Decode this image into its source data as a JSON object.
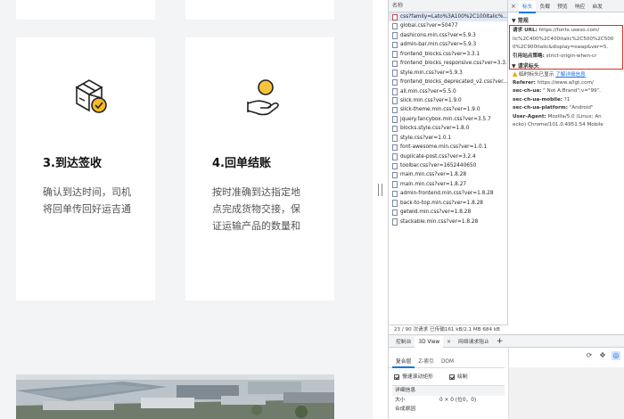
{
  "page": {
    "cards": [
      {
        "title": "3.到达签收",
        "desc_lines": [
          "确认到达时间，司机",
          "将回单传回好运吉通"
        ],
        "icon": "delivery-box-icon"
      },
      {
        "title": "4.回单结账",
        "desc_lines": [
          "按时准确到达指定地",
          "点完成货物交接，保",
          "证运输产品的数量和"
        ],
        "icon": "hand-coin-icon"
      }
    ],
    "photo_icon": "factory-aerial-photo"
  },
  "devtools": {
    "list_header": "名称",
    "requests": [
      "css?family=Lato%3A100%2C100italic%...",
      "global.css?ver=50477",
      "dashicons.min.css?ver=5.9.3",
      "admin-bar.min.css?ver=5.9.3",
      "frontend_blocks.css?ver=3.3.1",
      "frontend_blocks_responsive.css?ver=3.3.1",
      "style.min.css?ver=5.9.3",
      "frontend_blocks_deprecated_v2.css?ver...",
      "all.min.css?ver=5.5.0",
      "slick.min.css?ver=1.9.0",
      "slick-theme.min.css?ver=1.9.0",
      "jquery.fancybox.min.css?ver=3.5.7",
      "blocks.style.css?ver=1.8.0",
      "style.css?ver=1.0.1",
      "font-awesome.min.css?ver=1.0.1",
      "duplicate-post.css?ver=3.2.4",
      "toolbar.css?ver=1652440650",
      "main.min.css?ver=1.8.28",
      "main.min.css?ver=1.8.27",
      "admin-frontend.min.css?ver=1.8.28",
      "back-to-top.min.css?ver=1.8.28",
      "getwid.min.css?ver=1.8.28",
      "stackable.min.css?ver=1.8.28"
    ],
    "status_bar": "23 / 90 次请求  已传输161 kB/2.1 MB  684 kB",
    "detail_tabs": [
      "×",
      "标头",
      "负载",
      "预览",
      "响应",
      "启发"
    ],
    "general_label": "▼ 常规",
    "request_url_key": "请求 URL:",
    "request_url_value": "https://fonts.useso.com/",
    "url_line2": "lic%2C400%2C400italic%2C500%2C500",
    "url_line3": "0%2C900italic&display=swap&ver=5.",
    "referrer_policy_key": "引用站点策略:",
    "referrer_policy_value": "strict-origin-when-cr",
    "req_headers_label": "▼ 请求标头",
    "warning_text": "临时标头已显示",
    "warning_link": "了解详细信息",
    "headers": [
      {
        "k": "Referer:",
        "v": "https://www.a/lgt.com/"
      },
      {
        "k": "sec-ch-ua:",
        "v": "\" Not A;Brand\";v=\"99\","
      },
      {
        "k": "sec-ch-ua-mobile:",
        "v": "?1"
      },
      {
        "k": "sec-ch-ua-platform:",
        "v": "\"Android\""
      },
      {
        "k": "User-Agent:",
        "v": "Mozilla/5.0 (Linux; An"
      },
      {
        "k": "",
        "v": "ecko) Chrome/101.0.4951.54 Mobile"
      }
    ],
    "drawer_tabs": [
      "控制台",
      "3D View",
      "网络请求阻止"
    ],
    "drawer_plus": "+",
    "drawer_close": "×",
    "sub_tabs": [
      "复合层",
      "Z-索引",
      "DOM"
    ],
    "check_scroll": "慢速滚动矩形",
    "check_paint": "绘制",
    "detail_panel_title": "详细信息",
    "size_key": "大小",
    "size_value": "0 × 0 (位0，0)",
    "composite_key": "合成原因"
  }
}
